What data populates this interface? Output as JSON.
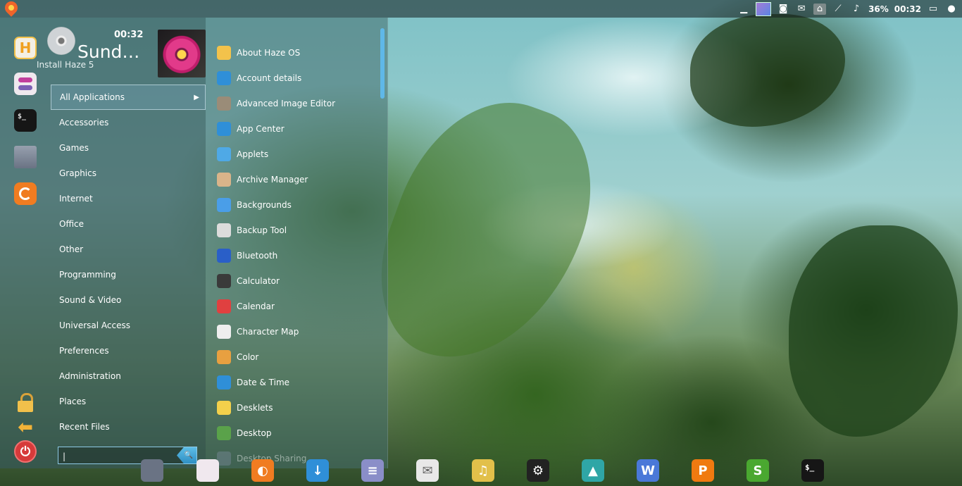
{
  "top_panel": {
    "battery": "36%",
    "clock": "00:32",
    "tray_icons": [
      "show-desktop-icon",
      "workspace-icon",
      "screenshot-icon",
      "mail-icon",
      "home-icon",
      "network-icon",
      "volume-icon",
      "battery-icon",
      "display-icon",
      "user-icon"
    ]
  },
  "menu": {
    "user": {
      "time": "00:32",
      "day": "Sund…",
      "install_label": "Install Haze 5"
    },
    "categories": [
      "All Applications",
      "Accessories",
      "Games",
      "Graphics",
      "Internet",
      "Office",
      "Other",
      "Programming",
      "Sound & Video",
      "Universal Access",
      "Preferences",
      "Administration",
      "Places",
      "Recent Files"
    ],
    "search": {
      "value": "|"
    },
    "applications": [
      {
        "label": "About Haze OS",
        "icon": "haze-icon",
        "color": "#f3c24b"
      },
      {
        "label": "Account details",
        "icon": "user-icon",
        "color": "#2f8fd8"
      },
      {
        "label": "Advanced Image Editor",
        "icon": "gimp-icon",
        "color": "#9a8c78"
      },
      {
        "label": "App Center",
        "icon": "download-icon",
        "color": "#2f8fd8"
      },
      {
        "label": "Applets",
        "icon": "applets-icon",
        "color": "#4fa9e6"
      },
      {
        "label": "Archive Manager",
        "icon": "archive-icon",
        "color": "#d9b48a"
      },
      {
        "label": "Backgrounds",
        "icon": "backgrounds-icon",
        "color": "#4a9ee8"
      },
      {
        "label": "Backup Tool",
        "icon": "backup-icon",
        "color": "#dcdcdc"
      },
      {
        "label": "Bluetooth",
        "icon": "bluetooth-icon",
        "color": "#2a5fc8"
      },
      {
        "label": "Calculator",
        "icon": "calculator-icon",
        "color": "#3a3a3a"
      },
      {
        "label": "Calendar",
        "icon": "calendar-icon",
        "color": "#e04040"
      },
      {
        "label": "Character Map",
        "icon": "character-map-icon",
        "color": "#eeeeee"
      },
      {
        "label": "Color",
        "icon": "color-icon",
        "color": "#e8a040"
      },
      {
        "label": "Date & Time",
        "icon": "clock-icon",
        "color": "#2f8fd8"
      },
      {
        "label": "Desklets",
        "icon": "desklets-icon",
        "color": "#f3d04b"
      },
      {
        "label": "Desktop",
        "icon": "desktop-icon",
        "color": "#5aa24a"
      },
      {
        "label": "Desktop Sharing",
        "icon": "desktop-sharing-icon",
        "color": "#7a8a9a"
      }
    ]
  },
  "dock": [
    {
      "name": "files-icon",
      "color": "#6a7384",
      "glyph": ""
    },
    {
      "name": "settings-icon",
      "color": "#f0e8ee",
      "glyph": ""
    },
    {
      "name": "firefox-icon",
      "color": "#f07c21",
      "glyph": "◐"
    },
    {
      "name": "app-center-icon",
      "color": "#2f8fd8",
      "glyph": "↓"
    },
    {
      "name": "text-editor-icon",
      "color": "#8a8ec8",
      "glyph": "≡"
    },
    {
      "name": "mail-icon",
      "color": "#e8e8e8",
      "glyph": "✉"
    },
    {
      "name": "music-icon",
      "color": "#e2c04a",
      "glyph": "♫"
    },
    {
      "name": "steam-icon",
      "color": "#222222",
      "glyph": "⚙"
    },
    {
      "name": "image-viewer-icon",
      "color": "#2fa6a6",
      "glyph": "▲"
    },
    {
      "name": "writer-icon",
      "color": "#4a78d8",
      "glyph": "W"
    },
    {
      "name": "presentation-icon",
      "color": "#f07a10",
      "glyph": "P"
    },
    {
      "name": "spreadsheet-icon",
      "color": "#4aa830",
      "glyph": "S"
    },
    {
      "name": "terminal-icon",
      "color": "#161616",
      "glyph": "$_"
    }
  ]
}
